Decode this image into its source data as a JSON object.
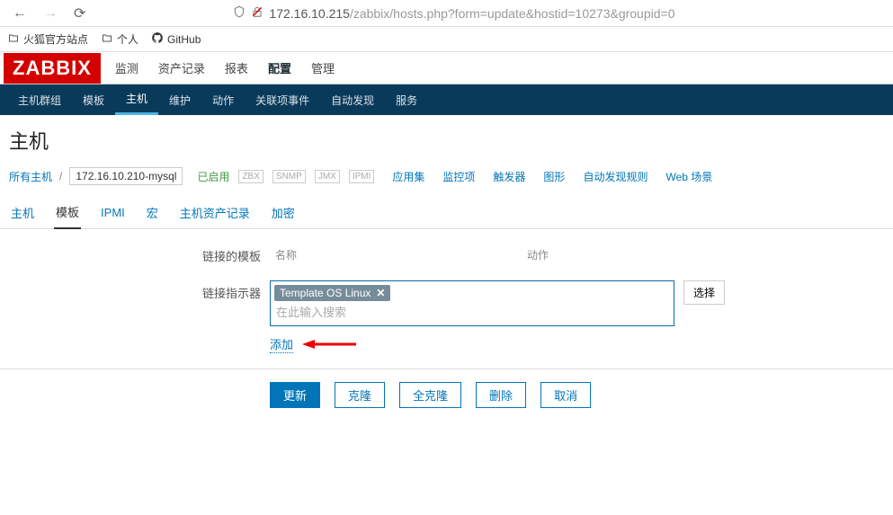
{
  "browser": {
    "url_host": "172.16.10.215",
    "url_path": "/zabbix/hosts.php?form=update&hostid=10273&groupid=0"
  },
  "bookmarks": {
    "firefox_official": "火狐官方站点",
    "personal": "个人",
    "github": "GitHub"
  },
  "logo": "ZABBIX",
  "top_menu": {
    "monitoring": "监测",
    "inventory": "资产记录",
    "reports": "报表",
    "configuration": "配置",
    "administration": "管理"
  },
  "sub_menu": {
    "hostgroups": "主机群组",
    "templates": "模板",
    "hosts": "主机",
    "maintenance": "维护",
    "actions": "动作",
    "correlation": "关联项事件",
    "discovery": "自动发现",
    "services": "服务"
  },
  "page_title": "主机",
  "crumb": {
    "all_hosts": "所有主机",
    "host_name": "172.16.10.210-mysql",
    "enabled": "已启用",
    "proto_zbx": "ZBX",
    "proto_snmp": "SNMP",
    "proto_jmx": "JMX",
    "proto_ipmi": "IPMI"
  },
  "sections": {
    "applications": "应用集",
    "items": "监控项",
    "triggers": "触发器",
    "graphs": "图形",
    "discovery": "自动发现规则",
    "web": "Web 场景"
  },
  "tabs": {
    "host": "主机",
    "templates": "模板",
    "ipmi": "IPMI",
    "macros": "宏",
    "inventory": "主机资产记录",
    "encryption": "加密"
  },
  "form": {
    "linked_templates": "链接的模板",
    "col_name": "名称",
    "col_action": "动作",
    "link_indicator": "链接指示器",
    "tag_template": "Template OS Linux",
    "search_placeholder": "在此输入搜索",
    "select_btn": "选择",
    "add_link": "添加"
  },
  "actions": {
    "update": "更新",
    "clone": "克隆",
    "full_clone": "全克隆",
    "delete": "删除",
    "cancel": "取消"
  }
}
